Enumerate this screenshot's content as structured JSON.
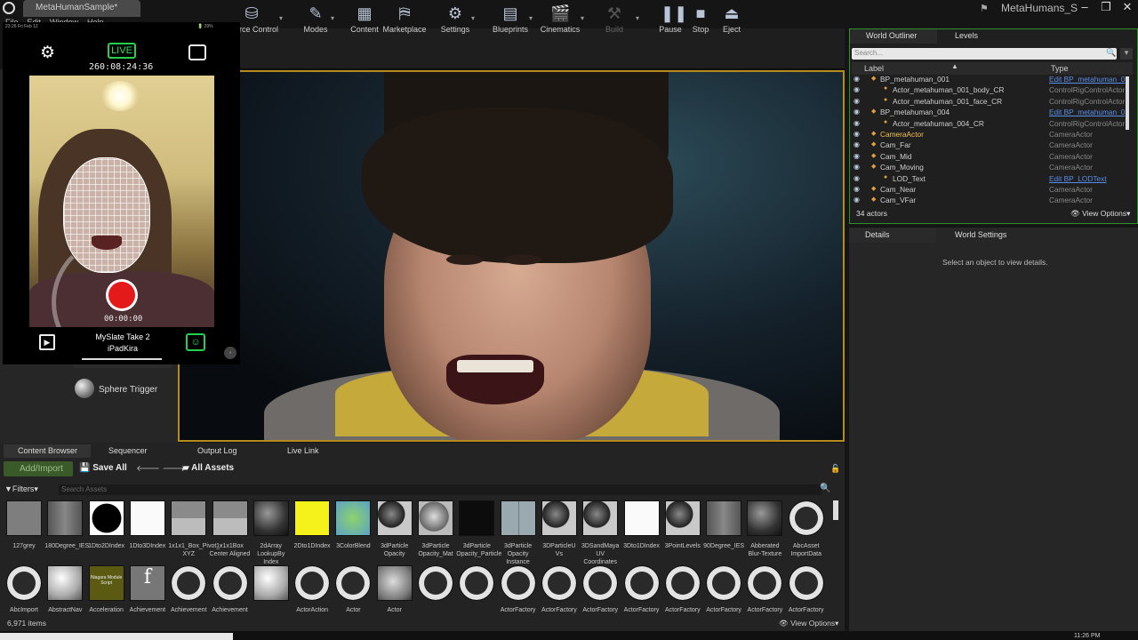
{
  "window": {
    "tab_title": "MetaHumanSample*",
    "project_name": "MetaHumans_S"
  },
  "menu": [
    "File",
    "Edit",
    "Window",
    "Help"
  ],
  "toolbar": [
    {
      "label": "Source Control",
      "icon": "source-control-icon"
    },
    {
      "label": "Modes",
      "icon": "modes-icon"
    },
    {
      "label": "Content",
      "icon": "content-icon"
    },
    {
      "label": "Marketplace",
      "icon": "marketplace-icon"
    },
    {
      "label": "Settings",
      "icon": "settings-icon"
    },
    {
      "label": "Blueprints",
      "icon": "blueprints-icon"
    },
    {
      "label": "Cinematics",
      "icon": "cinematics-icon"
    },
    {
      "label": "Build",
      "icon": "build-icon"
    },
    {
      "label": "Pause",
      "icon": "pause-icon"
    },
    {
      "label": "Stop",
      "icon": "stop-icon"
    },
    {
      "label": "Eject",
      "icon": "eject-icon"
    }
  ],
  "phone": {
    "status_left": "23:26  Fri Feb 12",
    "status_right": "🔋 29%",
    "live_label": "LIVE",
    "timecode": "260:08:24:36",
    "record_time": "00:00:00",
    "slate": "MySlate Take 2",
    "subject": "iPadKira"
  },
  "place_panel": {
    "item": "Sphere Trigger"
  },
  "outliner": {
    "tab1": "World Outliner",
    "tab2": "Levels",
    "search_placeholder": "Search...",
    "col_label": "Label",
    "col_type": "Type",
    "rows": [
      {
        "label": "BP_metahuman_001",
        "type": "Edit BP_metahuman_0",
        "link": true
      },
      {
        "label": "Actor_metahuman_001_body_CR",
        "type": "ControlRigControlActor"
      },
      {
        "label": "Actor_metahuman_001_face_CR",
        "type": "ControlRigControlActor"
      },
      {
        "label": "BP_metahuman_004",
        "type": "Edit BP_metahuman_0",
        "link": true
      },
      {
        "label": "Actor_metahuman_004_CR",
        "type": "ControlRigControlActor"
      },
      {
        "label": "CameraActor",
        "type": "CameraActor"
      },
      {
        "label": "Cam_Far",
        "type": "CameraActor"
      },
      {
        "label": "Cam_Mid",
        "type": "CameraActor"
      },
      {
        "label": "Cam_Moving",
        "type": "CameraActor"
      },
      {
        "label": "LOD_Text",
        "type": "Edit BP_LODText",
        "link": true
      },
      {
        "label": "Cam_Near",
        "type": "CameraActor"
      },
      {
        "label": "Cam_VFar",
        "type": "CameraActor"
      }
    ],
    "actor_count": "34 actors",
    "view_options": "View Options"
  },
  "details": {
    "tab1": "Details",
    "tab2": "World Settings",
    "empty_message": "Select an object to view details."
  },
  "bottom_tabs": [
    "Content Browser",
    "Sequencer",
    "Output Log",
    "Live Link"
  ],
  "content_browser": {
    "add_import": "Add/Import",
    "save_all": "Save All",
    "path": "All Assets",
    "filters": "Filters",
    "search_placeholder": "Search Assets",
    "item_count": "6,971 items",
    "view_options": "View Options",
    "row1": [
      {
        "label": "127grey",
        "kind": "grey"
      },
      {
        "label": "180Degree_IES",
        "kind": "gradient"
      },
      {
        "label": "1Dto2DIndex",
        "kind": "black-circle"
      },
      {
        "label": "1Dto3DIndex",
        "kind": "white"
      },
      {
        "label": "1x1x1_Box_Pivot_-XYZ",
        "kind": "box"
      },
      {
        "label": "1x1x1Box Center Aligned",
        "kind": "box"
      },
      {
        "label": "2dArray LookupBy Index",
        "kind": "sphere-dark"
      },
      {
        "label": "2Dto1DIndex",
        "kind": "yellow"
      },
      {
        "label": "3ColorBlend",
        "kind": "greenish"
      },
      {
        "label": "3dParticle Opacity",
        "kind": "sphere"
      },
      {
        "label": "3dParticle Opacity_Mat",
        "kind": "sphere-light"
      },
      {
        "label": "3dParticle Opacity_Particle",
        "kind": "dark"
      },
      {
        "label": "3dParticle Opacity Instance",
        "kind": "grid"
      },
      {
        "label": "3DParticleU Vs",
        "kind": "sphere"
      },
      {
        "label": "3DSandMaya UV Coordinates",
        "kind": "sphere"
      },
      {
        "label": "3Dto1DIndex",
        "kind": "white"
      },
      {
        "label": "3PointLevels",
        "kind": "sphere"
      },
      {
        "label": "90Degree_IES",
        "kind": "gradient"
      },
      {
        "label": "Abberated Blur-Texture",
        "kind": "sphere-dark"
      },
      {
        "label": "AbcAsset ImportData",
        "kind": "ring"
      }
    ],
    "row2": [
      {
        "label": "AbcImport",
        "kind": "ring"
      },
      {
        "label": "AbstractNav",
        "kind": "ball"
      },
      {
        "label": "Acceleration",
        "kind": "niagara",
        "text": "Niagara Module Script"
      },
      {
        "label": "Achievement",
        "kind": "func",
        "text": "f"
      },
      {
        "label": "Achievement",
        "kind": "ring"
      },
      {
        "label": "Achievement",
        "kind": "ring"
      },
      {
        "label": "",
        "kind": "ball"
      },
      {
        "label": "ActorAction",
        "kind": "ring"
      },
      {
        "label": "Actor",
        "kind": "ring"
      },
      {
        "label": "Actor",
        "kind": "capsule"
      },
      {
        "label": "",
        "kind": "ring"
      },
      {
        "label": "",
        "kind": "ring"
      },
      {
        "label": "ActorFactory",
        "kind": "ring"
      },
      {
        "label": "ActorFactory",
        "kind": "ring"
      },
      {
        "label": "ActorFactory",
        "kind": "ring"
      },
      {
        "label": "ActorFactory",
        "kind": "ring"
      },
      {
        "label": "ActorFactory",
        "kind": "ring"
      },
      {
        "label": "ActorFactory",
        "kind": "ring"
      },
      {
        "label": "ActorFactory",
        "kind": "ring"
      },
      {
        "label": "ActorFactory",
        "kind": "ring"
      }
    ]
  },
  "taskbar": {
    "clock": "11:26 PM"
  }
}
